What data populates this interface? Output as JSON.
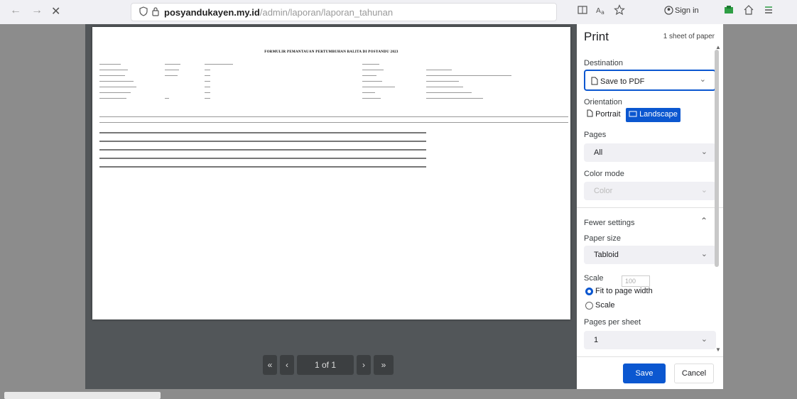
{
  "browser": {
    "url_domain": "posyandukayen.my.id",
    "url_path": "/admin/laporan/laporan_tahunan",
    "signin": "Sign in",
    "nav_back": "←",
    "nav_forward": "→",
    "nav_close": "✕"
  },
  "preview": {
    "sheet_title": "FORMULIR PEMANTAUAN PERTUMBUHAN BALITA DI POSYANDU 2023",
    "pager": {
      "first": "«",
      "prev": "‹",
      "page": "1 of 1",
      "next": "›",
      "last": "»"
    }
  },
  "panel": {
    "title": "Print",
    "sheets": "1 sheet of paper",
    "destination_label": "Destination",
    "destination_value": "Save to PDF",
    "orientation_label": "Orientation",
    "portrait": "Portrait",
    "landscape": "Landscape",
    "pages_label": "Pages",
    "pages_value": "All",
    "color_label": "Color mode",
    "color_value": "Color",
    "fewer_settings": "Fewer settings",
    "paper_size_label": "Paper size",
    "paper_size_value": "Tabloid",
    "scale_label": "Scale",
    "fit_to_page": "Fit to page width",
    "scale_option": "Scale",
    "scale_value": "100",
    "pages_per_sheet_label": "Pages per sheet",
    "pages_per_sheet_value": "1",
    "save": "Save",
    "cancel": "Cancel"
  },
  "colors": {
    "accent": "#0b57d0",
    "overlay": "#525659"
  }
}
